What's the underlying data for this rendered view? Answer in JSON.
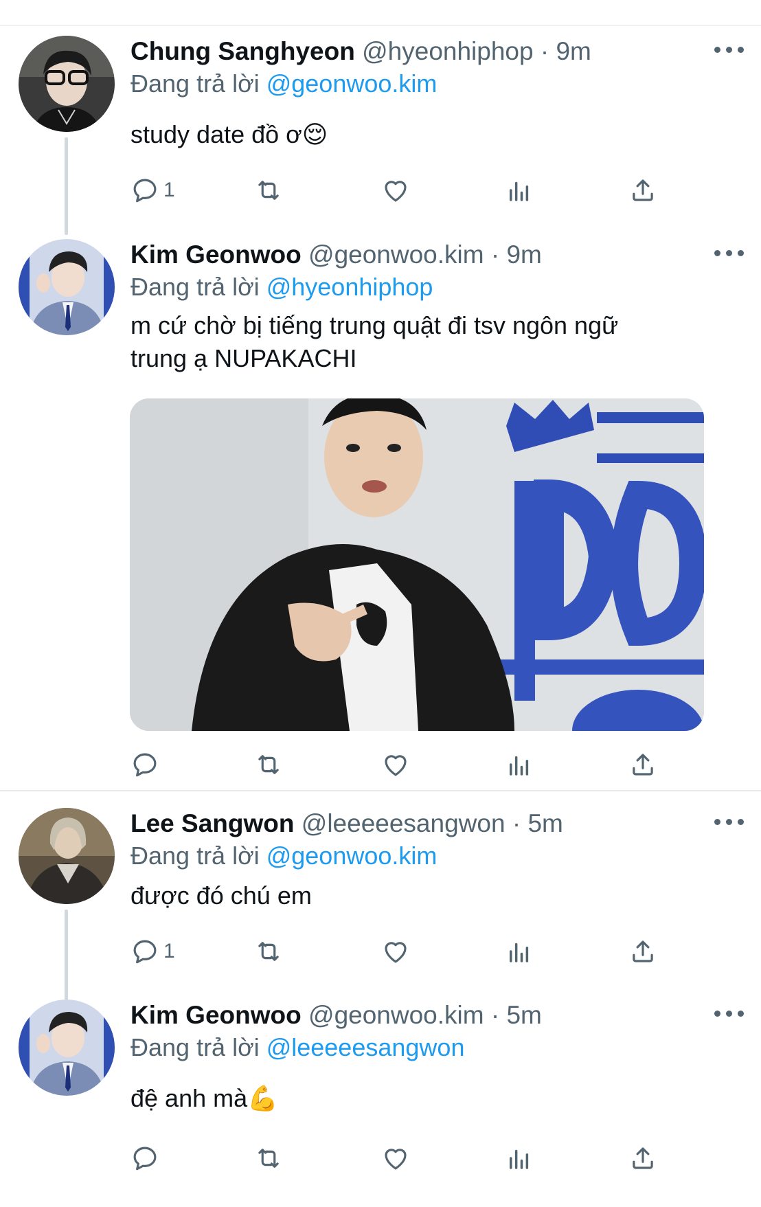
{
  "replying_prefix": "Đang trả lời",
  "tweets": [
    {
      "name": "Chung Sanghyeon",
      "handle": "@hyeonhiphop",
      "separator": "·",
      "time": "9m",
      "replying_to": "@geonwoo.kim",
      "text": "study date đồ ơ",
      "emoji": "😌",
      "reply_count": "1"
    },
    {
      "name": "Kim Geonwoo",
      "handle": "@geonwoo.kim",
      "separator": "·",
      "time": "9m",
      "replying_to": "@hyeonhiphop",
      "text_line1": "m cứ chờ bị tiếng trung quật đi tsv ngôn ngữ",
      "text_line2": "trung ạ NUPAKACHI",
      "reply_count": ""
    },
    {
      "name": "Lee Sangwon",
      "handle": "@leeeeesangwon",
      "separator": "·",
      "time": "5m",
      "replying_to": "@geonwoo.kim",
      "text": "được đó chú em",
      "reply_count": "1"
    },
    {
      "name": "Kim Geonwoo",
      "handle": "@geonwoo.kim",
      "separator": "·",
      "time": "5m",
      "replying_to": "@leeeeesangwon",
      "text": "đệ anh mà",
      "emoji": "💪",
      "reply_count": ""
    }
  ],
  "icons": [
    "reply-icon",
    "retweet-icon",
    "like-icon",
    "analytics-icon",
    "share-icon",
    "more-icon"
  ],
  "colors": {
    "link": "#1d9bf0",
    "secondary": "#536471",
    "primary_text": "#0f1419",
    "thread_line": "#cfd9de"
  }
}
